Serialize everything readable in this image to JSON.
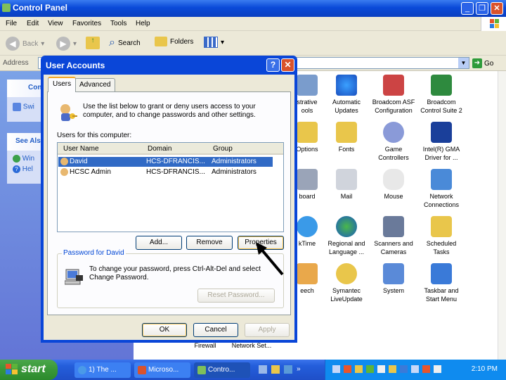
{
  "window": {
    "title": "Control Panel"
  },
  "menu": [
    "File",
    "Edit",
    "View",
    "Favorites",
    "Tools",
    "Help"
  ],
  "toolbar": {
    "back": "Back",
    "search": "Search",
    "folders": "Folders"
  },
  "address": {
    "label": "Address",
    "go": "Go"
  },
  "taskpane": {
    "panel1_title": "Con",
    "panel1_item": "Swi",
    "panel2_title": "See Als",
    "panel2_items": [
      "Win",
      "Hel"
    ]
  },
  "icons": [
    "strative\nools",
    "Automatic\nUpdates",
    "Broadcom ASF\nConfiguration",
    "Broadcom\nControl Suite 2",
    "Options",
    "Fonts",
    "Game\nControllers",
    "Intel(R) GMA\nDriver for ...",
    "board",
    "Mail",
    "Mouse",
    "Network\nConnections",
    "kTime",
    "Regional and\nLanguage ...",
    "Scanners and\nCameras",
    "Scheduled\nTasks",
    "eech",
    "Symantec\nLiveUpdate",
    "System",
    "Taskbar and\nStart Menu",
    "Firewall",
    "Network Set..."
  ],
  "taskbar": {
    "start": "start",
    "tasks": [
      "1) The ...",
      "Microso...",
      "Contro..."
    ],
    "clock": "2:10 PM"
  },
  "dialog": {
    "title": "User Accounts",
    "tabs": [
      "Users",
      "Advanced"
    ],
    "intro": "Use the list below to grant or deny users access to your computer, and to change passwords and other settings.",
    "users_label": "Users for this computer:",
    "columns": [
      "User Name",
      "Domain",
      "Group"
    ],
    "rows": [
      {
        "name": "David",
        "domain": "HCS-DFRANCIS...",
        "group": "Administrators"
      },
      {
        "name": "HCSC Admin",
        "domain": "HCS-DFRANCIS...",
        "group": "Administrators"
      }
    ],
    "buttons": {
      "add": "Add...",
      "remove": "Remove",
      "properties": "Properties"
    },
    "password_group": "Password for David",
    "password_text": "To change your password, press Ctrl-Alt-Del and select Change Password.",
    "reset_password": "Reset Password...",
    "ok": "OK",
    "cancel": "Cancel",
    "apply": "Apply"
  }
}
